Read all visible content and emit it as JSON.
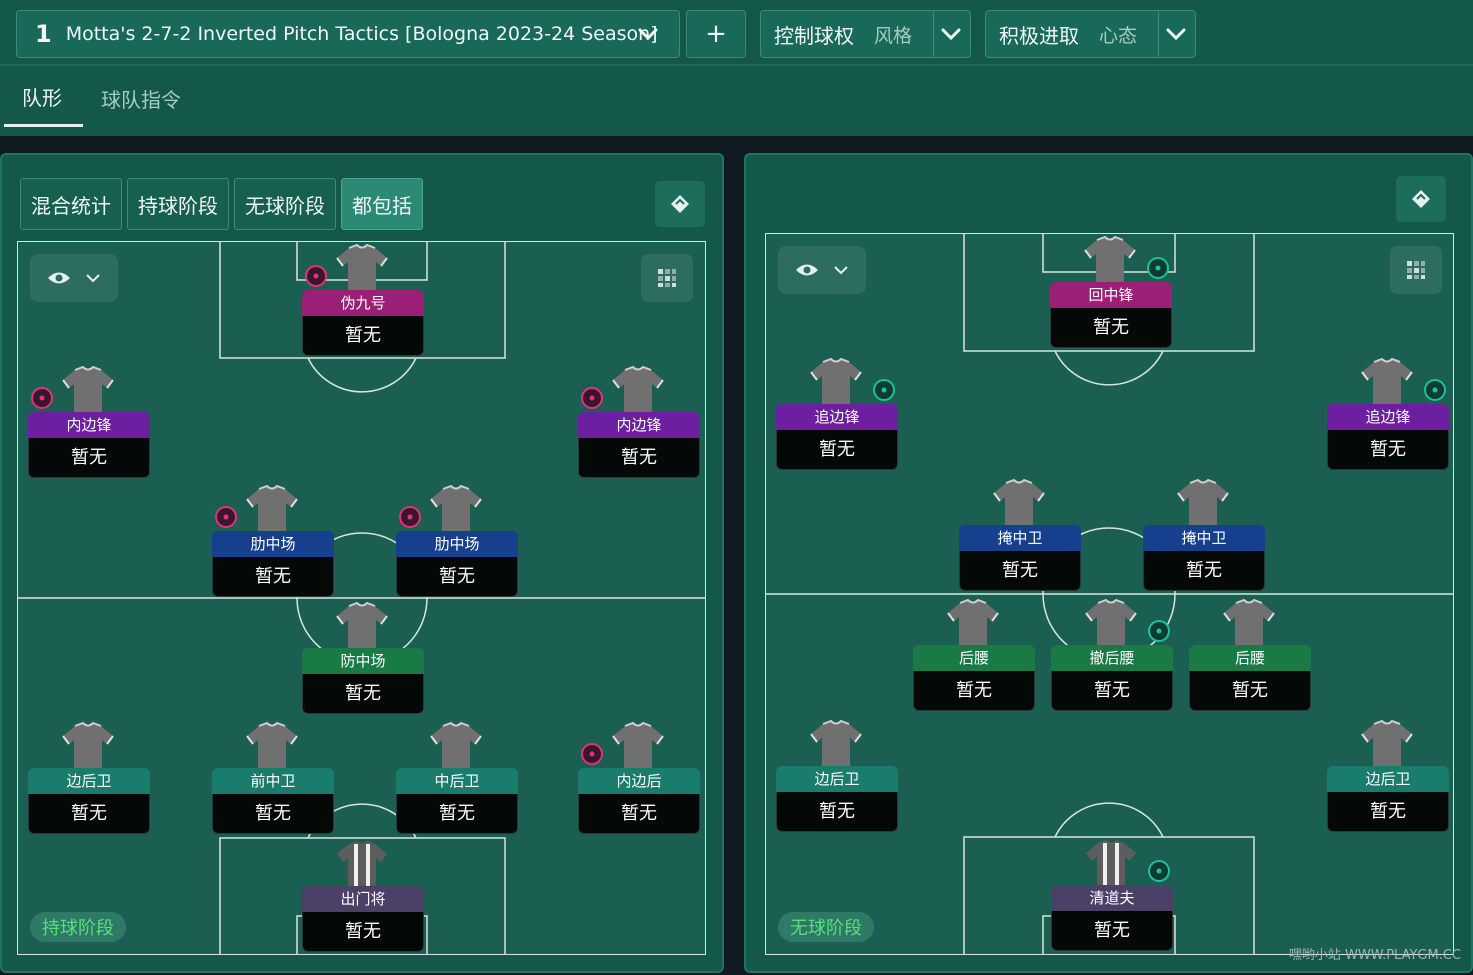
{
  "header": {
    "tactic_number": "1",
    "tactic_name": "Motta's 2-7-2 Inverted Pitch Tactics [Bologna 2023-24 Season]",
    "add_label": "+",
    "style_value": "控制球权",
    "style_key": "风格",
    "mentality_value": "积极进取",
    "mentality_key": "心态"
  },
  "tabs": {
    "formation": "队形",
    "team_instructions": "球队指令"
  },
  "left_panel": {
    "phase_tabs": [
      "混合统计",
      "持球阶段",
      "无球阶段",
      "都包括"
    ],
    "phase_label": "持球阶段",
    "players": [
      {
        "role": "伪九号",
        "name": "暂无",
        "color": "magenta",
        "badge": "pink"
      },
      {
        "role": "内边锋",
        "name": "暂无",
        "color": "purple",
        "badge": "pink"
      },
      {
        "role": "内边锋",
        "name": "暂无",
        "color": "purple",
        "badge": "pink"
      },
      {
        "role": "肋中场",
        "name": "暂无",
        "color": "blue",
        "badge": "pink"
      },
      {
        "role": "肋中场",
        "name": "暂无",
        "color": "blue",
        "badge": "pink"
      },
      {
        "role": "防中场",
        "name": "暂无",
        "color": "green",
        "badge": ""
      },
      {
        "role": "边后卫",
        "name": "暂无",
        "color": "teal",
        "badge": ""
      },
      {
        "role": "前中卫",
        "name": "暂无",
        "color": "teal",
        "badge": ""
      },
      {
        "role": "中后卫",
        "name": "暂无",
        "color": "teal",
        "badge": ""
      },
      {
        "role": "内边后",
        "name": "暂无",
        "color": "teal",
        "badge": "pink"
      },
      {
        "role": "出门将",
        "name": "暂无",
        "color": "slate",
        "badge": "",
        "gk": true
      }
    ]
  },
  "right_panel": {
    "phase_label": "无球阶段",
    "players": [
      {
        "role": "回中锋",
        "name": "暂无",
        "color": "magenta",
        "badge": "teal"
      },
      {
        "role": "追边锋",
        "name": "暂无",
        "color": "purple",
        "badge": "teal"
      },
      {
        "role": "追边锋",
        "name": "暂无",
        "color": "purple",
        "badge": "teal"
      },
      {
        "role": "掩中卫",
        "name": "暂无",
        "color": "blue",
        "badge": ""
      },
      {
        "role": "掩中卫",
        "name": "暂无",
        "color": "blue",
        "badge": ""
      },
      {
        "role": "后腰",
        "name": "暂无",
        "color": "green",
        "badge": ""
      },
      {
        "role": "撤后腰",
        "name": "暂无",
        "color": "green",
        "badge": "teal"
      },
      {
        "role": "后腰",
        "name": "暂无",
        "color": "green",
        "badge": ""
      },
      {
        "role": "边后卫",
        "name": "暂无",
        "color": "teal",
        "badge": ""
      },
      {
        "role": "边后卫",
        "name": "暂无",
        "color": "teal",
        "badge": ""
      },
      {
        "role": "清道夫",
        "name": "暂无",
        "color": "slate",
        "badge": "teal",
        "gk": true
      }
    ]
  },
  "icons": {
    "chevron": "chevron-down-icon",
    "eye": "eye-icon",
    "grid": "grid-icon",
    "swap": "swap-icon"
  },
  "watermark": "嘿哟小站 WWW.PLAYGM.CC"
}
